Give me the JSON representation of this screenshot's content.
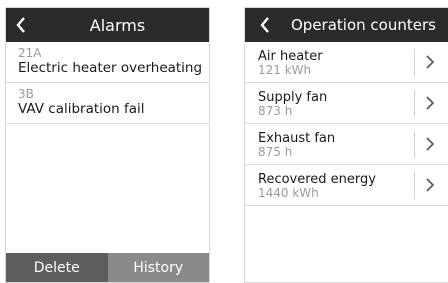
{
  "alarms_panel": {
    "title": "Alarms",
    "items": [
      {
        "code": "21A",
        "description": "Electric heater overheating"
      },
      {
        "code": "3B",
        "description": "VAV calibration fail"
      }
    ],
    "delete_label": "Delete",
    "history_label": "History"
  },
  "counters_panel": {
    "title": "Operation counters",
    "items": [
      {
        "label": "Air heater",
        "value": "121 kWh"
      },
      {
        "label": "Supply fan",
        "value": "873 h"
      },
      {
        "label": "Exhaust fan",
        "value": "875 h"
      },
      {
        "label": "Recovered energy",
        "value": "1440 kWh"
      }
    ]
  },
  "colors": {
    "header_bg": "#2b2b2b",
    "delete_bg": "#5e5e5e",
    "history_bg": "#8a8a8a",
    "secondary_text": "#9b9b9b"
  }
}
